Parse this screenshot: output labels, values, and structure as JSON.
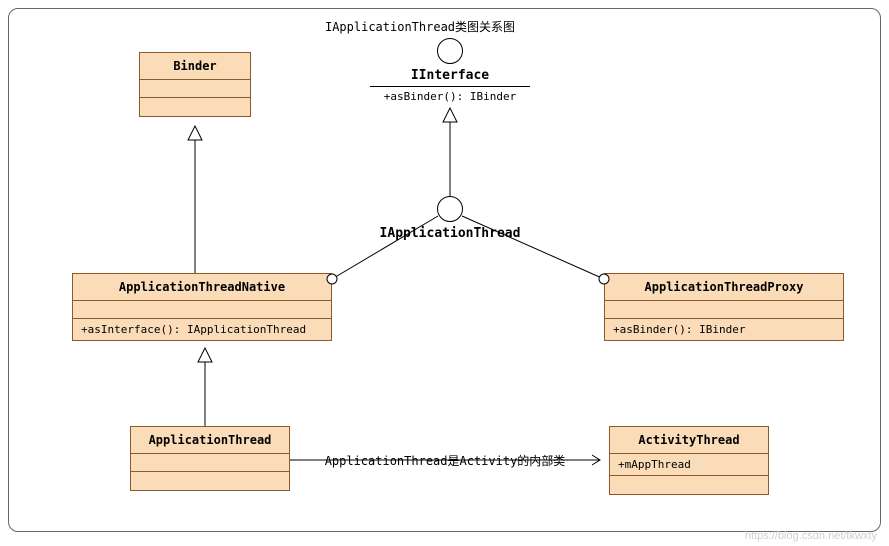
{
  "title": "IApplicationThread类图关系图",
  "interfaces": {
    "iinterface": {
      "name": "IInterface",
      "method": "+asBinder(): IBinder"
    },
    "iapplicationthread": {
      "name": "IApplicationThread"
    }
  },
  "classes": {
    "binder": {
      "name": "Binder"
    },
    "app_thread_native": {
      "name": "ApplicationThreadNative",
      "method": "+asInterface(): IApplicationThread"
    },
    "app_thread_proxy": {
      "name": "ApplicationThreadProxy",
      "method": "+asBinder(): IBinder"
    },
    "application_thread": {
      "name": "ApplicationThread"
    },
    "activity_thread": {
      "name": "ActivityThread",
      "attr": "+mAppThread"
    }
  },
  "relation_label": "ApplicationThread是Activity的内部类",
  "watermark": "https://blog.csdn.net/tkwxty"
}
